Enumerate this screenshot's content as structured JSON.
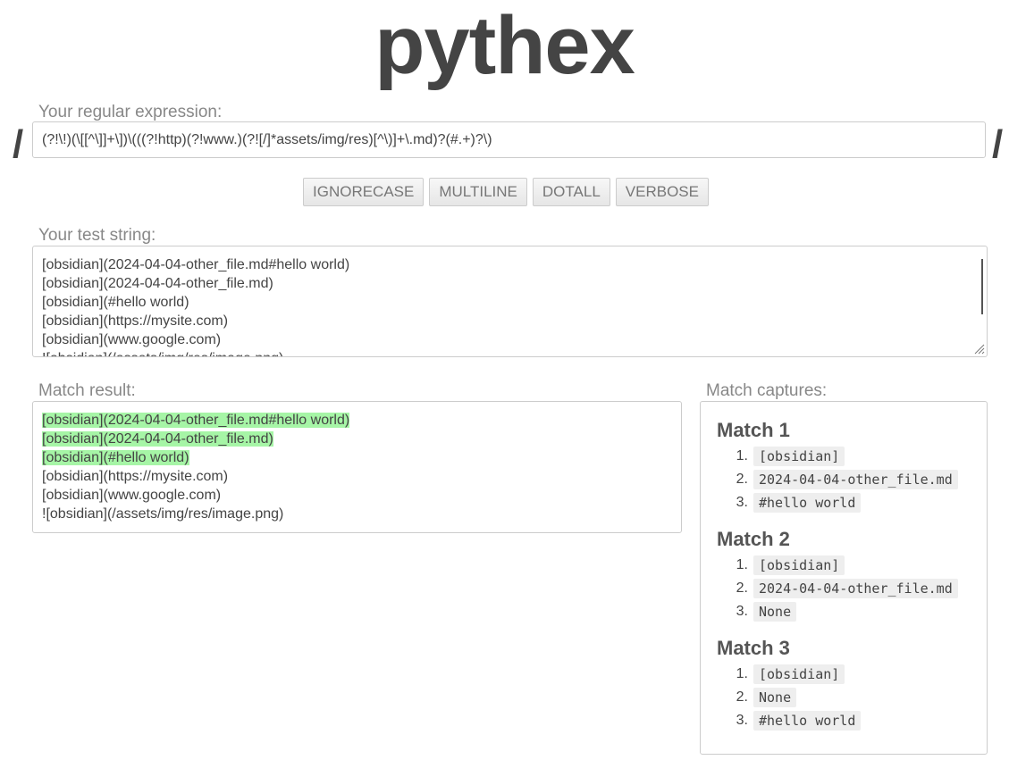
{
  "app": {
    "title": "pythex"
  },
  "regex": {
    "label": "Your regular expression:",
    "value": "(?!\\!)(\\[[^\\]]+\\])\\(((?!http)(?!www.)(?![/]*assets/img/res)[^\\)]+\\.md)?(#.+)?\\)",
    "delimiter_left": "/",
    "delimiter_right": "/"
  },
  "flags": [
    "IGNORECASE",
    "MULTILINE",
    "DOTALL",
    "VERBOSE"
  ],
  "test_string": {
    "label": "Your test string:",
    "lines": [
      "[obsidian](2024-04-04-other_file.md#hello world)",
      "[obsidian](2024-04-04-other_file.md)",
      "[obsidian](#hello world)",
      "[obsidian](https://mysite.com)",
      "[obsidian](www.google.com)",
      "![obsidian](/assets/img/res/image.png)"
    ]
  },
  "match_result": {
    "label": "Match result:",
    "lines": [
      {
        "text": "[obsidian](2024-04-04-other_file.md#hello world)",
        "matched": true
      },
      {
        "text": "[obsidian](2024-04-04-other_file.md)",
        "matched": true
      },
      {
        "text": "[obsidian](#hello world)",
        "matched": true
      },
      {
        "text": "[obsidian](https://mysite.com)",
        "matched": false
      },
      {
        "text": "[obsidian](www.google.com)",
        "matched": false
      },
      {
        "text": "![obsidian](/assets/img/res/image.png)",
        "matched": false
      }
    ],
    "highlight_color": "#a6f5a6"
  },
  "captures": {
    "label": "Match captures:",
    "matches": [
      {
        "title": "Match 1",
        "groups": [
          "[obsidian]",
          "2024-04-04-other_file.md",
          "#hello world"
        ]
      },
      {
        "title": "Match 2",
        "groups": [
          "[obsidian]",
          "2024-04-04-other_file.md",
          "None"
        ]
      },
      {
        "title": "Match 3",
        "groups": [
          "[obsidian]",
          "None",
          "#hello world"
        ]
      }
    ]
  }
}
